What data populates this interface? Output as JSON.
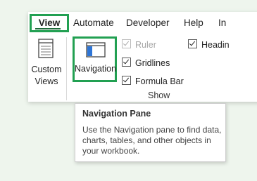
{
  "ribbon": {
    "tabs": [
      "View",
      "Automate",
      "Developer",
      "Help",
      "In"
    ],
    "active_tab": "View",
    "custom_views_label_line1": "Custom",
    "custom_views_label_line2": "Views",
    "navigation_label": "Navigation",
    "show_group": {
      "label": "Show",
      "ruler": {
        "label": "Ruler",
        "checked": true,
        "disabled": true
      },
      "gridlines": {
        "label": "Gridlines",
        "checked": true
      },
      "formula_bar": {
        "label": "Formula Bar",
        "checked": true
      },
      "headings": {
        "label": "Headin",
        "checked": true
      }
    }
  },
  "tooltip": {
    "title": "Navigation Pane",
    "body": "Use the Navigation pane to find data, charts, tables, and other objects in your workbook."
  },
  "colors": {
    "highlight": "#22a052",
    "accent": "#1f6b3a",
    "background": "#eef5ed"
  }
}
